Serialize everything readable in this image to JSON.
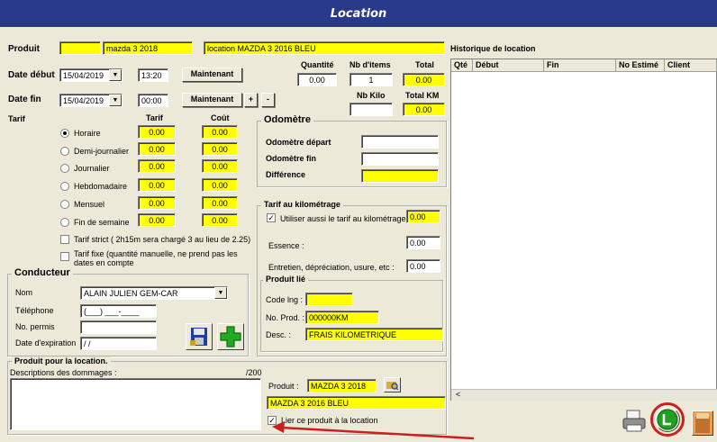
{
  "window": {
    "title": "Location"
  },
  "produit": {
    "label": "Produit",
    "code": "",
    "name": "mazda 3 2018",
    "desc": "location MAZDA 3 2016 BLEU"
  },
  "dates": {
    "debut_label": "Date début",
    "debut_date": "15/04/2019",
    "debut_time": "13:20",
    "fin_label": "Date fin",
    "fin_date": "15/04/2019",
    "fin_time": "00:00",
    "maintenant": "Maintenant",
    "plus": "+",
    "minus": "-"
  },
  "totals": {
    "quantite_label": "Quantité",
    "quantite": "0.00",
    "nb_items_label": "Nb d'items",
    "nb_items": "1",
    "total_label": "Total",
    "total": "0.00",
    "nb_kilo_label": "Nb Kilo",
    "nb_kilo": "",
    "total_km_label": "Total KM",
    "total_km": "0.00"
  },
  "tarif": {
    "label": "Tarif",
    "col_tarif": "Tarif",
    "col_cout": "Coût",
    "rows": [
      {
        "label": "Horaire",
        "tarif": "0.00",
        "cout": "0.00",
        "selected": true
      },
      {
        "label": "Demi-journalier",
        "tarif": "0.00",
        "cout": "0.00",
        "selected": false
      },
      {
        "label": "Journalier",
        "tarif": "0.00",
        "cout": "0.00",
        "selected": false
      },
      {
        "label": "Hebdomadaire",
        "tarif": "0.00",
        "cout": "0.00",
        "selected": false
      },
      {
        "label": "Mensuel",
        "tarif": "0.00",
        "cout": "0.00",
        "selected": false
      },
      {
        "label": "Fin de semaine",
        "tarif": "0.00",
        "cout": "0.00",
        "selected": false
      }
    ],
    "strict": "Tarif strict ( 2h15m sera chargé 3 au lieu de 2.25)",
    "fixe_1": "Tarif fixe (quantité manuelle, ne prend pas les",
    "fixe_2": "dates en compte"
  },
  "odometre": {
    "title": "Odomètre",
    "depart": "Odomètre départ",
    "fin": "Odomètre fin",
    "difference": "Différence"
  },
  "km": {
    "title": "Tarif au kilométrage",
    "use_label": "Utiliser aussi le tarif au kilométrage",
    "use_value": "0.00",
    "essence_label": "Essence :",
    "essence": "0.00",
    "entretien_label": "Entretien, dépréciation, usure, etc :",
    "entretien": "0.00"
  },
  "produit_lie": {
    "title": "Produit lié",
    "code_label": "Code lng :",
    "code": "",
    "no_label": "No. Prod. :",
    "no": "000000KM",
    "desc_label": "Desc. :",
    "desc": "FRAIS KILOMETRIQUE"
  },
  "conducteur": {
    "title": "Conducteur",
    "nom_label": "Nom",
    "nom": "ALAIN JULIEN GEM-CAR",
    "tel_label": "Téléphone",
    "tel": "(___) ___-____",
    "permis_label": "No. permis",
    "permis": "",
    "exp_label": "Date d'expiration",
    "exp": " / /"
  },
  "location_produit": {
    "title": "Produit pour la location.",
    "dommages_label": "Descriptions des dommages :",
    "dommages_count": "/200",
    "produit_label": "Produit :",
    "produit": "MAZDA 3 2018",
    "produit_desc": "MAZDA 3 2016 BLEU",
    "lier_label": "Lier ce produit à la location"
  },
  "historique": {
    "title": "Historique de location",
    "columns": [
      "Qté",
      "Début",
      "Fin",
      "No Estimé",
      "Client"
    ]
  },
  "colors": {
    "highlight": "#ffff00",
    "titlebar": "#2a3a8a",
    "annotation": "#cc1f1f"
  }
}
